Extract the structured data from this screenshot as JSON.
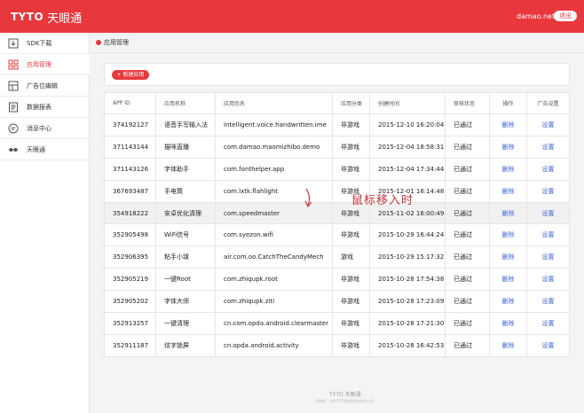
{
  "brand": {
    "mark": "TYTO",
    "name": "天眼通"
  },
  "header": {
    "user": "damao.net",
    "logout": "退出"
  },
  "sidebar": {
    "items": [
      {
        "label": "SDK下载",
        "icon": "download-icon",
        "active": false
      },
      {
        "label": "应用管理",
        "icon": "grid-icon",
        "active": true
      },
      {
        "label": "广告位编辑",
        "icon": "layout-icon",
        "active": false
      },
      {
        "label": "数据报表",
        "icon": "report-icon",
        "active": false
      },
      {
        "label": "消息中心",
        "icon": "message-icon",
        "active": false
      },
      {
        "label": "天眼通",
        "icon": "tyto-icon",
        "active": false
      }
    ]
  },
  "breadcrumb": {
    "current": "应用管理"
  },
  "toolbar": {
    "new_label": "+ 新建应用"
  },
  "table": {
    "headers": [
      "APP ID",
      "应用名称",
      "应用包名",
      "应用分类",
      "创建时间",
      "审核状态",
      "操作",
      "广告设置"
    ],
    "rows": [
      [
        "374192127",
        "语音手写输入法",
        "intelligent.voice.handwritten.ime",
        "非游戏",
        "2015-12-10 16:20:04",
        "已通过",
        "删除",
        "设置"
      ],
      [
        "371143144",
        "猫咪直播",
        "com.damao.maomizhibo.demo",
        "非游戏",
        "2015-12-04 18:58:31",
        "已通过",
        "删除",
        "设置"
      ],
      [
        "371143126",
        "字体助手",
        "com.fonthelper.app",
        "非游戏",
        "2015-12-04 17:34:44",
        "已通过",
        "删除",
        "设置"
      ],
      [
        "367693487",
        "手电筒",
        "com.lxtk.flahlight",
        "非游戏",
        "2015-12-01 16:14:48",
        "已通过",
        "删除",
        "设置"
      ],
      [
        "354918222",
        "安卓优化清理",
        "com.speedmaster",
        "非游戏",
        "2015-11-02 16:00:49",
        "已通过",
        "删除",
        "设置"
      ],
      [
        "352905498",
        "WiFi信号",
        "com.syezon.wifi",
        "非游戏",
        "2015-10-29 16:44:24",
        "已通过",
        "删除",
        "设置"
      ],
      [
        "352906395",
        "粘手小球",
        "air.com.oo.CatchTheCandyMech",
        "游戏",
        "2015-10-29 15:17:32",
        "已通过",
        "删除",
        "设置"
      ],
      [
        "352905219",
        "一键Root",
        "com.zhiqupk.root",
        "非游戏",
        "2015-10-28 17:54:38",
        "已通过",
        "删除",
        "设置"
      ],
      [
        "352905202",
        "字体大师",
        "com.zhiqupk.ziti",
        "非游戏",
        "2015-10-28 17:23:09",
        "已通过",
        "删除",
        "设置"
      ],
      [
        "352913257",
        "一键清理",
        "cn.com.opda.android.clearmaster",
        "非游戏",
        "2015-10-28 17:21:30",
        "已通过",
        "删除",
        "设置"
      ],
      [
        "352911187",
        "炫字锁屏",
        "cn.opda.android.activity",
        "非游戏",
        "2015-10-28 16:42:53",
        "已通过",
        "删除",
        "设置"
      ]
    ],
    "hover_row": 4
  },
  "annotation": {
    "text": "鼠标移入时"
  },
  "footer": {
    "brand": "TYTO 天眼通",
    "copy": "天眼通 · 北京TYTO数据科技有限公司"
  },
  "colors": {
    "accent": "#e8383d",
    "link": "#3d63d9"
  }
}
